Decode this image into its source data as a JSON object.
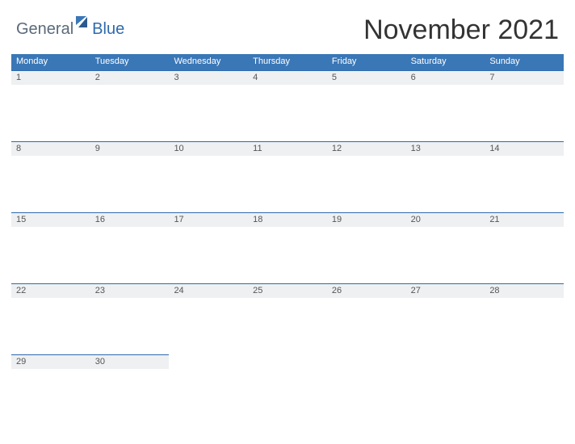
{
  "logo": {
    "text1": "General",
    "text2": "Blue"
  },
  "title": "November 2021",
  "weekdays": [
    "Monday",
    "Tuesday",
    "Wednesday",
    "Thursday",
    "Friday",
    "Saturday",
    "Sunday"
  ],
  "weeks": [
    [
      "1",
      "2",
      "3",
      "4",
      "5",
      "6",
      "7"
    ],
    [
      "8",
      "9",
      "10",
      "11",
      "12",
      "13",
      "14"
    ],
    [
      "15",
      "16",
      "17",
      "18",
      "19",
      "20",
      "21"
    ],
    [
      "22",
      "23",
      "24",
      "25",
      "26",
      "27",
      "28"
    ],
    [
      "29",
      "30",
      "",
      "",
      "",
      "",
      ""
    ]
  ],
  "colors": {
    "header_bg": "#3a77b7",
    "band_bg": "#eef0f2",
    "band_border": "#2f6aad"
  }
}
